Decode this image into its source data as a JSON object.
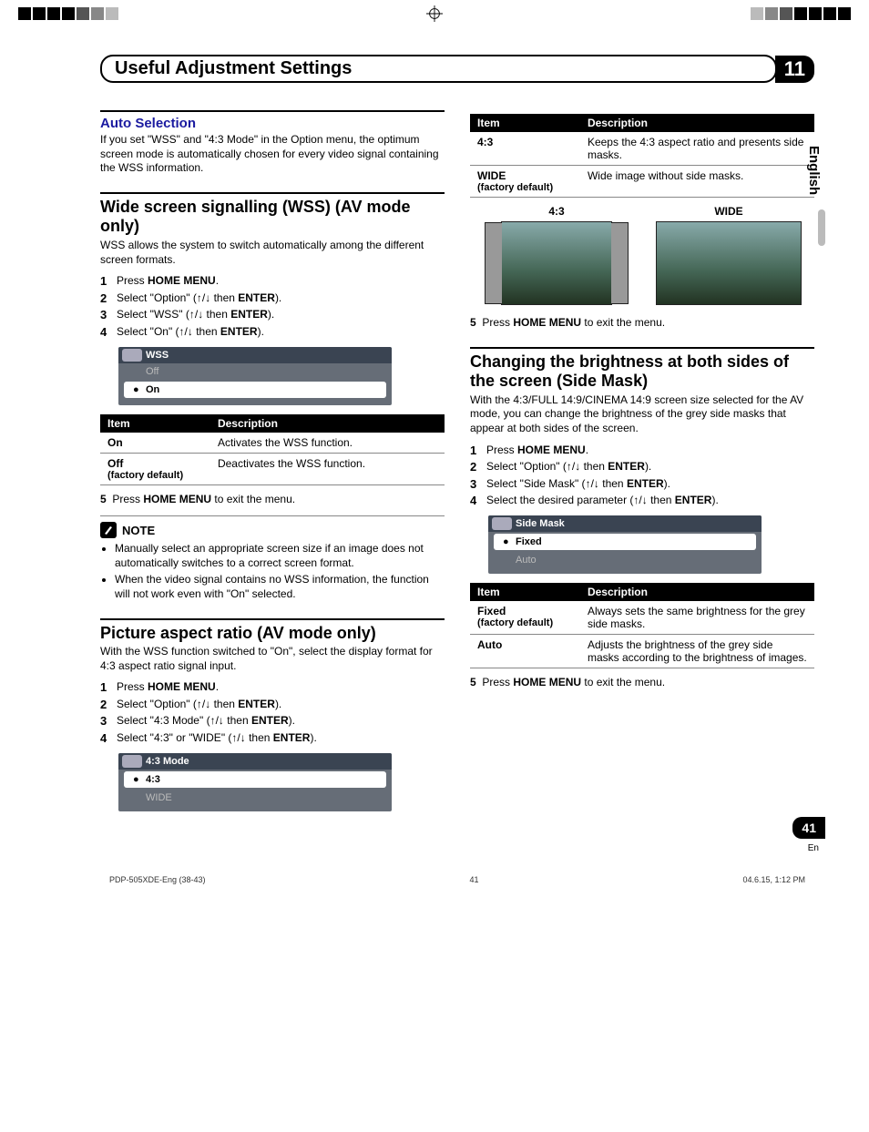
{
  "chapter_number": "11",
  "chapter_title": "Useful Adjustment Settings",
  "language_tab": "English",
  "page_number": "41",
  "page_lang": "En",
  "auto_selection": {
    "heading": "Auto Selection",
    "body": "If you set \"WSS\" and \"4:3 Mode\" in the Option menu, the optimum screen mode is automatically chosen for every video signal containing the WSS information."
  },
  "wss": {
    "heading": "Wide screen signalling (WSS) (AV mode only)",
    "body": "WSS allows the system to switch automatically among the different screen formats.",
    "steps": [
      {
        "pre": "Press ",
        "bold": "HOME MENU",
        "post": "."
      },
      {
        "pre": "Select \"Option\" (",
        "arrows": true,
        "mid": " then ",
        "bold": "ENTER",
        "post": ")."
      },
      {
        "pre": "Select \"WSS\" (",
        "arrows": true,
        "mid": " then ",
        "bold": "ENTER",
        "post": ")."
      },
      {
        "pre": "Select \"On\" (",
        "arrows": true,
        "mid": " then ",
        "bold": "ENTER",
        "post": ")."
      }
    ],
    "menu": {
      "title": "WSS",
      "items": [
        "Off",
        "On"
      ],
      "selected": 1
    },
    "table": {
      "headers": [
        "Item",
        "Description"
      ],
      "rows": [
        {
          "item": "On",
          "default": false,
          "desc": "Activates the WSS function."
        },
        {
          "item": "Off",
          "default": true,
          "desc": "Deactivates the WSS function."
        }
      ]
    },
    "step5": {
      "num": "5",
      "pre": "Press ",
      "bold": "HOME MENU",
      "post": " to exit the menu."
    },
    "note_label": "NOTE",
    "notes": [
      "Manually select an appropriate screen size if an image does not automatically switches to a correct screen format.",
      "When the video signal contains no WSS information, the function will not work even with \"On\" selected."
    ]
  },
  "aspect": {
    "heading": "Picture aspect ratio (AV mode only)",
    "body": "With the WSS function switched to \"On\", select the display format for 4:3 aspect ratio signal input.",
    "steps": [
      {
        "pre": "Press ",
        "bold": "HOME MENU",
        "post": "."
      },
      {
        "pre": "Select \"Option\" (",
        "arrows": true,
        "mid": " then ",
        "bold": "ENTER",
        "post": ")."
      },
      {
        "pre": "Select \"4:3 Mode\" (",
        "arrows": true,
        "mid": " then ",
        "bold": "ENTER",
        "post": ")."
      },
      {
        "pre": "Select \"4:3\" or \"WIDE\" (",
        "arrows": true,
        "mid": " then ",
        "bold": "ENTER",
        "post": ")."
      }
    ],
    "menu": {
      "title": "4:3 Mode",
      "items": [
        "4:3",
        "WIDE"
      ],
      "selected": 0
    },
    "table": {
      "headers": [
        "Item",
        "Description"
      ],
      "rows": [
        {
          "item": "4:3",
          "default": false,
          "desc": "Keeps the 4:3 aspect ratio and presents side masks."
        },
        {
          "item": "WIDE",
          "default": true,
          "desc": "Wide image without side masks."
        }
      ]
    },
    "captions": {
      "left": "4:3",
      "right": "WIDE"
    },
    "step5": {
      "num": "5",
      "pre": "Press ",
      "bold": "HOME MENU",
      "post": " to exit the menu."
    }
  },
  "sidemask": {
    "heading": "Changing the brightness at both sides of the screen (Side Mask)",
    "body": "With the 4:3/FULL 14:9/CINEMA 14:9 screen size selected for the AV mode, you can change the brightness of the grey side masks that appear at both sides of the screen.",
    "steps": [
      {
        "pre": "Press ",
        "bold": "HOME MENU",
        "post": "."
      },
      {
        "pre": "Select \"Option\" (",
        "arrows": true,
        "mid": " then ",
        "bold": "ENTER",
        "post": ")."
      },
      {
        "pre": "Select \"Side Mask\" (",
        "arrows": true,
        "mid": " then ",
        "bold": "ENTER",
        "post": ")."
      },
      {
        "pre": "Select the desired parameter (",
        "arrows": true,
        "mid": " then ",
        "bold": "ENTER",
        "post": ")."
      }
    ],
    "menu": {
      "title": "Side Mask",
      "items": [
        "Fixed",
        "Auto"
      ],
      "selected": 0
    },
    "table": {
      "headers": [
        "Item",
        "Description"
      ],
      "rows": [
        {
          "item": "Fixed",
          "default": true,
          "desc": "Always sets the same brightness for the grey side masks."
        },
        {
          "item": "Auto",
          "default": false,
          "desc": "Adjusts the brightness of the grey side masks according to the brightness of images."
        }
      ]
    },
    "step5": {
      "num": "5",
      "pre": "Press ",
      "bold": "HOME MENU",
      "post": " to exit the menu."
    }
  },
  "factory_default_label": "(factory default)",
  "footer": {
    "left": "PDP-505XDE-Eng (38-43)",
    "mid": "41",
    "right": "04.6.15, 1:12 PM"
  }
}
